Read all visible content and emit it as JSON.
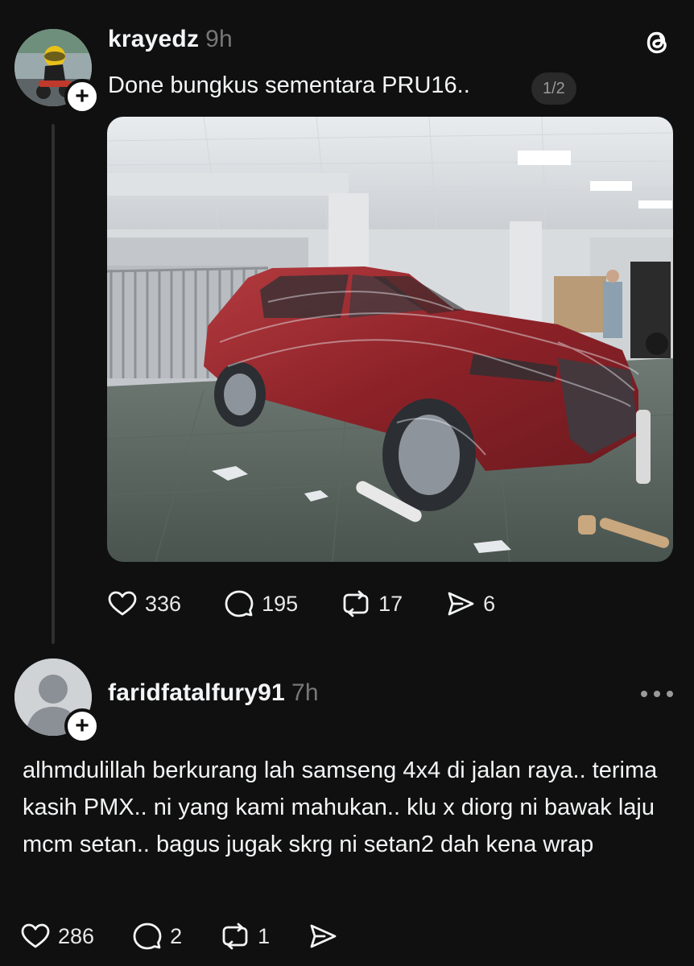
{
  "post1": {
    "username": "krayedz",
    "time": "9h",
    "text": "Done bungkus sementara PRU16..",
    "page_indicator": "1/2",
    "image_alt_subject": "plastic-wrapped red pickup truck in parking area",
    "stats": {
      "likes": "336",
      "replies": "195",
      "reposts": "17",
      "shares": "6"
    }
  },
  "post2": {
    "username": "faridfatalfury91",
    "time": "7h",
    "text": "alhmdulillah berkurang lah samseng 4x4 di jalan raya.. terima kasih PMX.. ni yang kami mahukan.. klu x diorg ni bawak laju mcm setan.. bagus jugak skrg ni setan2 dah kena wrap",
    "stats": {
      "likes": "286",
      "replies": "2",
      "reposts": "1",
      "shares": ""
    }
  },
  "colors": {
    "background": "#101010",
    "text": "#f3f5f7",
    "muted": "#777777",
    "thread_line": "#2f2f2f"
  },
  "icons": [
    "threads-logo-icon",
    "heart-icon",
    "comment-icon",
    "repost-icon",
    "share-icon",
    "more-icon",
    "plus-icon",
    "default-avatar-icon"
  ]
}
